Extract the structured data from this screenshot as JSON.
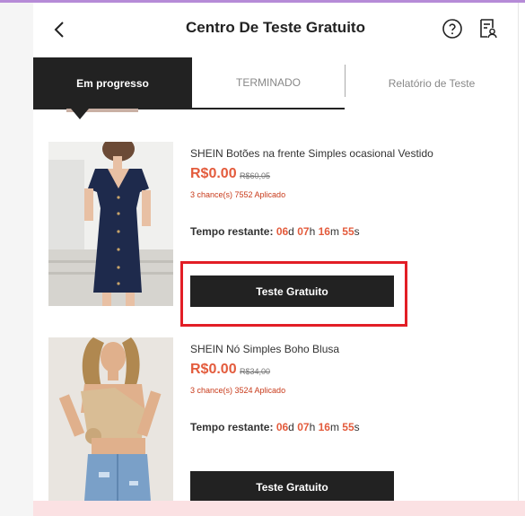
{
  "header": {
    "title": "Centro De Teste Gratuito"
  },
  "icons": {
    "back": "chevron-left-icon",
    "help": "question-circle-icon",
    "report": "report-user-icon"
  },
  "tabs": [
    {
      "label": "Em progresso",
      "active": true
    },
    {
      "label": "TERMINADO",
      "active": false
    },
    {
      "label": "Relatório de Teste",
      "active": false
    }
  ],
  "products": [
    {
      "name": "SHEIN Botões na frente Simples ocasional Vestido",
      "price": "R$0.00",
      "original_price": "R$60,05",
      "chances": "3 chance(s) 7552 Aplicado",
      "timer_label": "Tempo restante:",
      "days": "06",
      "hours": "07",
      "minutes": "16",
      "seconds": "55",
      "unit_d": "d",
      "unit_h": "h",
      "unit_m": "m",
      "unit_s": "s",
      "cta": "Teste Gratuito"
    },
    {
      "name": "SHEIN Nó Simples Boho Blusa",
      "price": "R$0.00",
      "original_price": "R$34,00",
      "chances": "3 chance(s) 3524 Aplicado",
      "timer_label": "Tempo restante:",
      "days": "06",
      "hours": "07",
      "minutes": "16",
      "seconds": "55",
      "unit_d": "d",
      "unit_h": "h",
      "unit_m": "m",
      "unit_s": "s",
      "cta": "Teste Gratuito"
    }
  ],
  "colors": {
    "accent": "#e35b3c",
    "dark": "#222222",
    "highlight": "#e21e26",
    "banner": "#fbe1e3"
  }
}
